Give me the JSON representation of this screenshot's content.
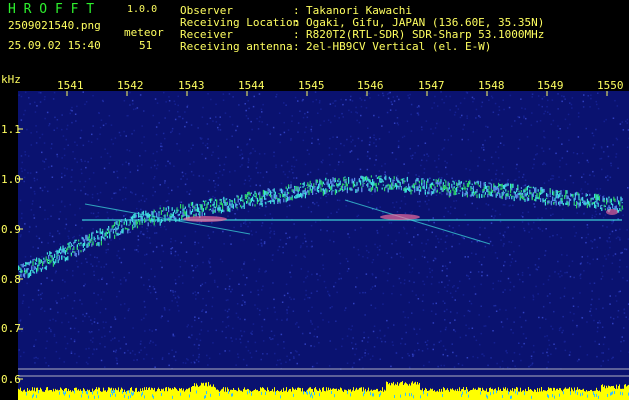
{
  "app": {
    "title": "H R O F F T",
    "version": "1.0.0"
  },
  "file": {
    "name": "2509021540.png",
    "datetime": "25.09.02 15:40"
  },
  "meteor": {
    "label": "meteor",
    "count": "51"
  },
  "info": [
    {
      "label": "Observer",
      "sep": ":",
      "value": "Takanori Kawachi"
    },
    {
      "label": "Receiving Location",
      "sep": ":",
      "value": "Ogaki, Gifu, JAPAN (136.60E, 35.35N)"
    },
    {
      "label": "Receiver",
      "sep": ":",
      "value": "R820T2(RTL-SDR) SDR-Sharp 53.1000MHz"
    },
    {
      "label": "Receiving antenna",
      "sep": ":",
      "value": "2el-HB9CV Vertical (el. E-W)"
    }
  ],
  "x_axis": {
    "ticks": [
      "1541",
      "1542",
      "1543",
      "1544",
      "1545",
      "1546",
      "1547",
      "1548",
      "1549",
      "1550"
    ]
  },
  "y_axis": {
    "unit": "kHz",
    "ticks": [
      "1.1",
      "1.0",
      "0.9",
      "0.8",
      "0.7",
      "0.6"
    ]
  },
  "colors": {
    "background": "#000000",
    "spectrogram_bg": "#0a1270",
    "text": "#ffff60",
    "title": "#2ef02e",
    "echo": "#40e0e0",
    "echo_hot": "#ff70a0",
    "level": "#ffff00"
  }
}
